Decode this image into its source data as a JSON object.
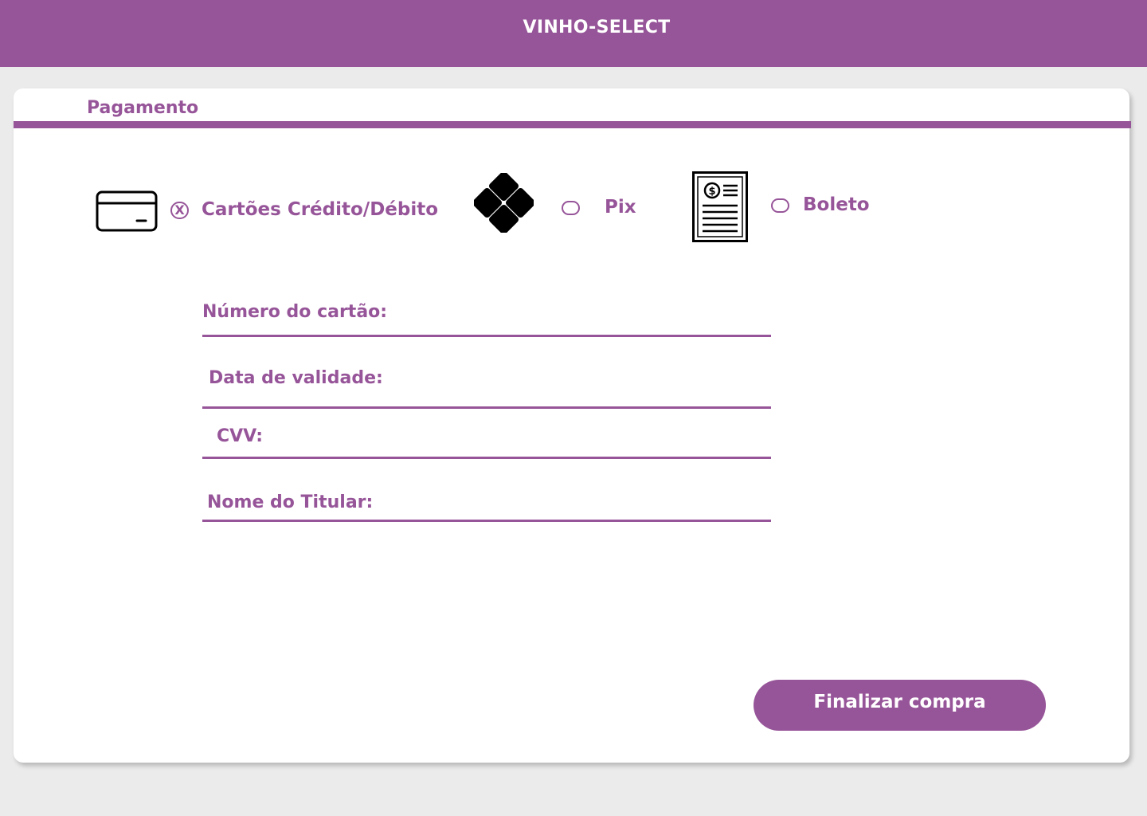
{
  "header": {
    "title": "VINHO-SELECT"
  },
  "payment": {
    "section_title": "Pagamento",
    "methods": [
      {
        "id": "card",
        "label": "Cartões Crédito/Débito",
        "icon": "credit-card-icon",
        "selected": true
      },
      {
        "id": "pix",
        "label": "Pix",
        "icon": "pix-icon",
        "selected": false
      },
      {
        "id": "boleto",
        "label": "Boleto",
        "icon": "boleto-document-icon",
        "selected": false
      }
    ],
    "selected_mark": "X",
    "fields": {
      "card_number": "Número  do cartão:",
      "expiry": "Data de validade:",
      "cvv": "CVV:",
      "holder_name": "Nome do Titular:"
    },
    "submit_label": "Finalizar compra"
  },
  "colors": {
    "accent": "#975599",
    "background": "#ebebeb",
    "card": "#ffffff"
  }
}
